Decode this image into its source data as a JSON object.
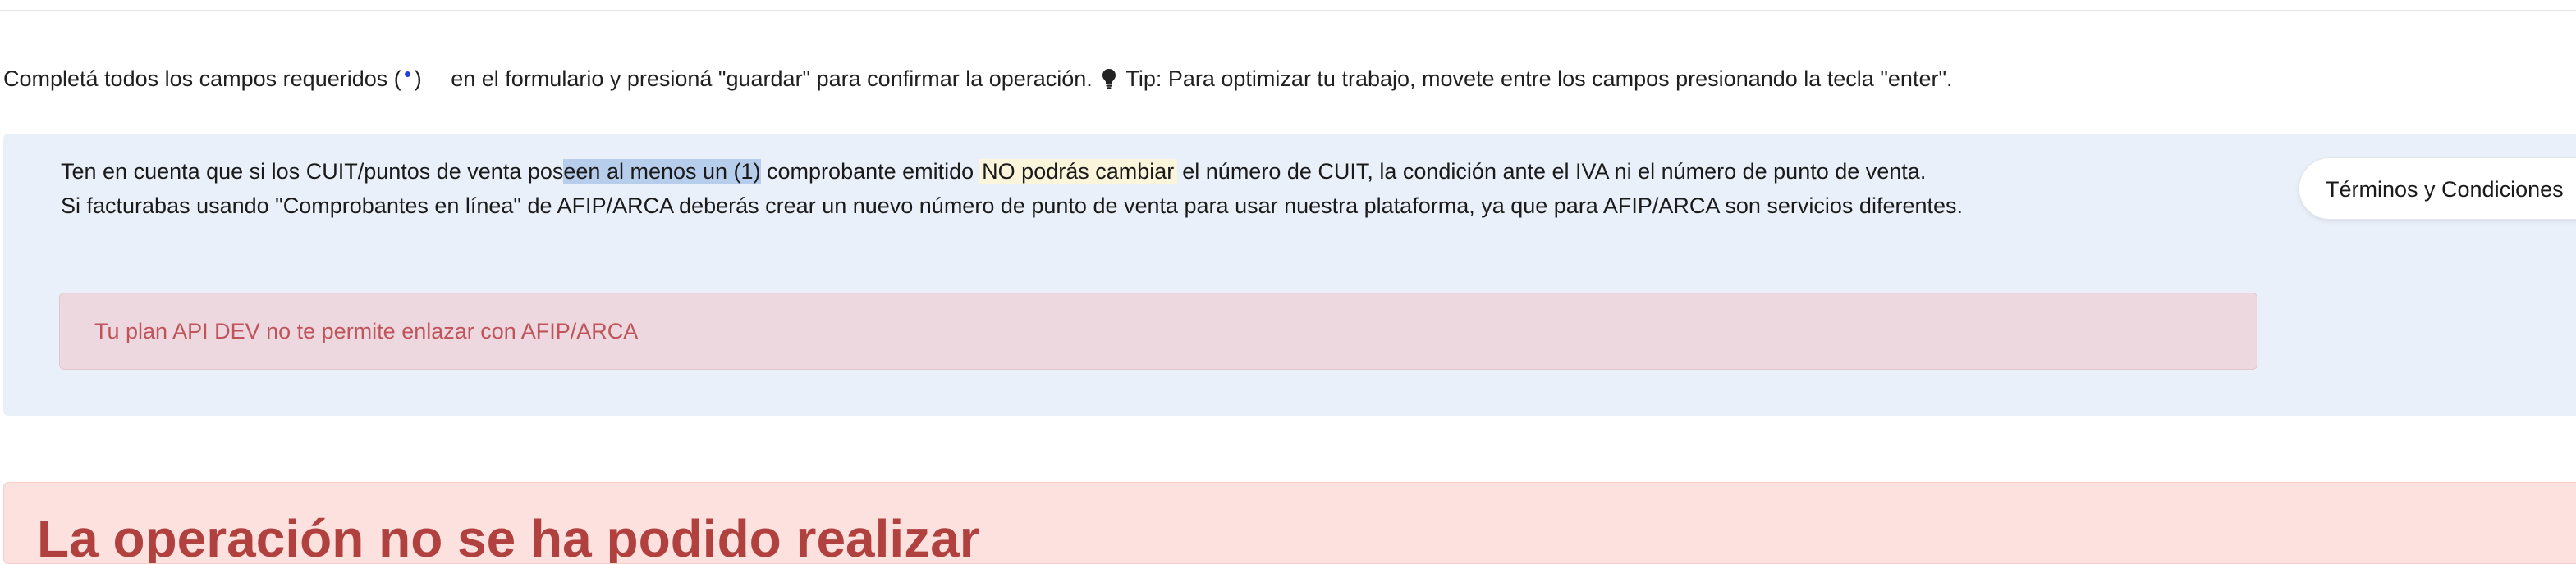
{
  "instructions": {
    "part1": "Completá todos los campos requeridos (",
    "part2": ")",
    "part3": "en el formulario y presioná \"guardar\" para confirmar la operación.",
    "tip": "Tip: Para optimizar tu trabajo, movete entre los campos presionando la tecla \"enter\".",
    "required_marker_color": "#2340d8",
    "tip_icon": "lightbulb-icon"
  },
  "info": {
    "line1_a": "Ten en cuenta que si los CUIT/puntos de venta pos",
    "line1_selected": "een al menos un (1)",
    "line1_b": " comprobante emitido",
    "line1_highlight": "NO podrás cambiar",
    "line1_c": "el número de CUIT, la condición ante el IVA ni el número de punto de venta.",
    "line2": "Si facturabas usando \"Comprobantes en línea\" de AFIP/ARCA deberás crear un nuevo número de punto de venta para usar nuestra plataforma, ya que para AFIP/ARCA son servicios diferentes.",
    "terms_button": "Términos y Condiciones"
  },
  "alert": {
    "message": "Tu plan API DEV no te permite enlazar con AFIP/ARCA",
    "color": "#c0545a"
  },
  "error": {
    "title": "La operación no se ha podido realizar",
    "color": "#b0413e"
  }
}
